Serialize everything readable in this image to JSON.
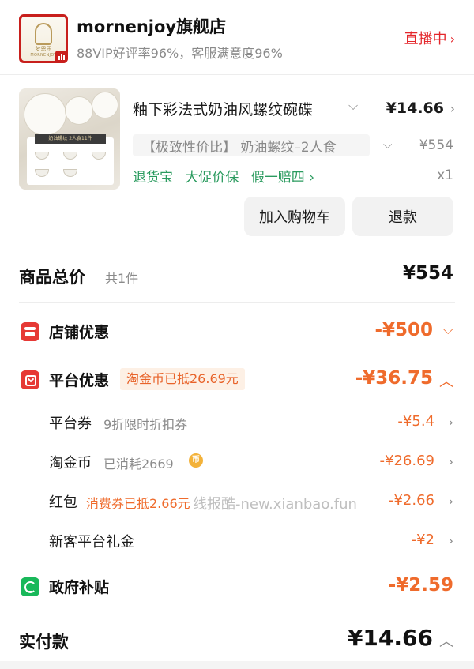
{
  "store": {
    "name": "mornenjoy旗舰店",
    "stats": "88VIP好评率96%，客服满意度96%",
    "live_label": "直播中",
    "logo_cn": "梦恩乐",
    "logo_en": "MORNENJOY"
  },
  "product": {
    "title": "釉下彩法式奶油风螺纹碗碟",
    "price": "¥14.66",
    "spec": "【极致性价比】 奶油螺纹–2人食",
    "original_price": "¥554",
    "services": [
      "退货宝",
      "大促价保",
      "假一赔四 ›"
    ],
    "quantity": "x1",
    "image_tag": "奶油螺纹 2人食11件"
  },
  "actions": {
    "add_cart": "加入购物车",
    "refund": "退款"
  },
  "summary": {
    "total_label": "商品总价",
    "total_count": "共1件",
    "total_value": "¥554",
    "store_discount_label": "店铺优惠",
    "store_discount_value": "-¥500",
    "platform_discount_label": "平台优惠",
    "platform_badge": "淘金币已抵26.69元",
    "platform_discount_value": "-¥36.75",
    "platform_items": [
      {
        "label": "平台券",
        "note": "9折限时折扣券",
        "value": "-¥5.4"
      },
      {
        "label": "淘金币",
        "note": "已消耗2669",
        "value": "-¥26.69"
      },
      {
        "label": "红包",
        "note": "消费券已抵2.66元",
        "value": "-¥2.66"
      },
      {
        "label": "新客平台礼金",
        "note": "",
        "value": "-¥2"
      }
    ],
    "gov_label": "政府补贴",
    "gov_value": "-¥2.59",
    "pay_label": "实付款",
    "pay_value": "¥14.66"
  },
  "watermark": "线报酷-new.xianbao.fun",
  "coin_glyph": "币",
  "colors": {
    "red": "#e4262b",
    "orange": "#ef6b2c",
    "green": "#2b9b5f",
    "gray": "#8a8a8a"
  }
}
